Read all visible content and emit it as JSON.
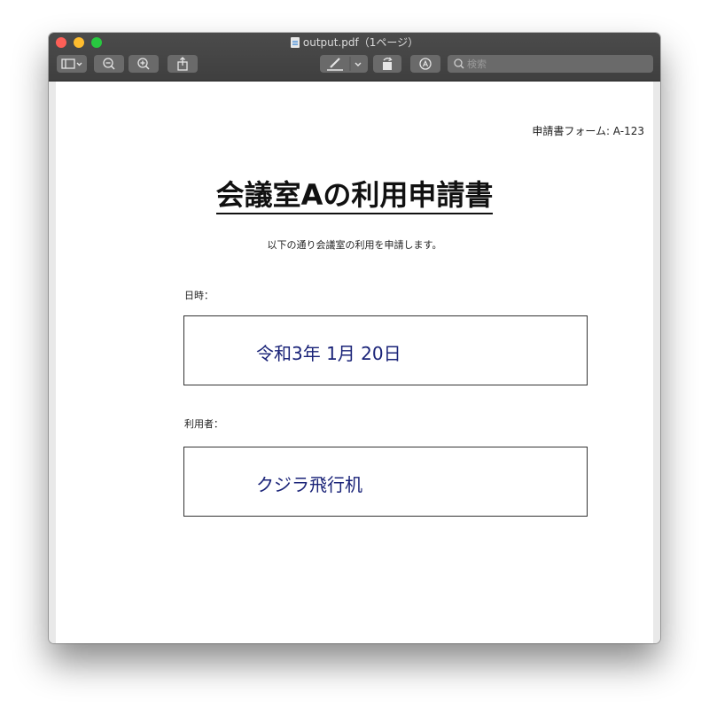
{
  "window": {
    "title": "output.pdf（1ページ）"
  },
  "toolbar": {
    "sidebar_label": "",
    "search_placeholder": "検索"
  },
  "document": {
    "form_id": "申請書フォーム: A-123",
    "title": "会議室Aの利用申請書",
    "intro": "以下の通り会議室の利用を申請します。",
    "fields": [
      {
        "label": "日時：",
        "value": "令和3年 1月 20日"
      },
      {
        "label": "利用者：",
        "value": "クジラ飛行机"
      }
    ]
  },
  "colors": {
    "titlebar": "#444444",
    "close": "#fd5f57",
    "minimize": "#febc2e",
    "maximize": "#28c840",
    "field_value": "#1a2378"
  },
  "icons": [
    "sidebar-icon",
    "chevron-down-icon",
    "zoom-out-icon",
    "zoom-in-icon",
    "share-icon",
    "markup-pen-icon",
    "rotate-icon",
    "annotate-icon",
    "search-icon",
    "document-icon"
  ]
}
